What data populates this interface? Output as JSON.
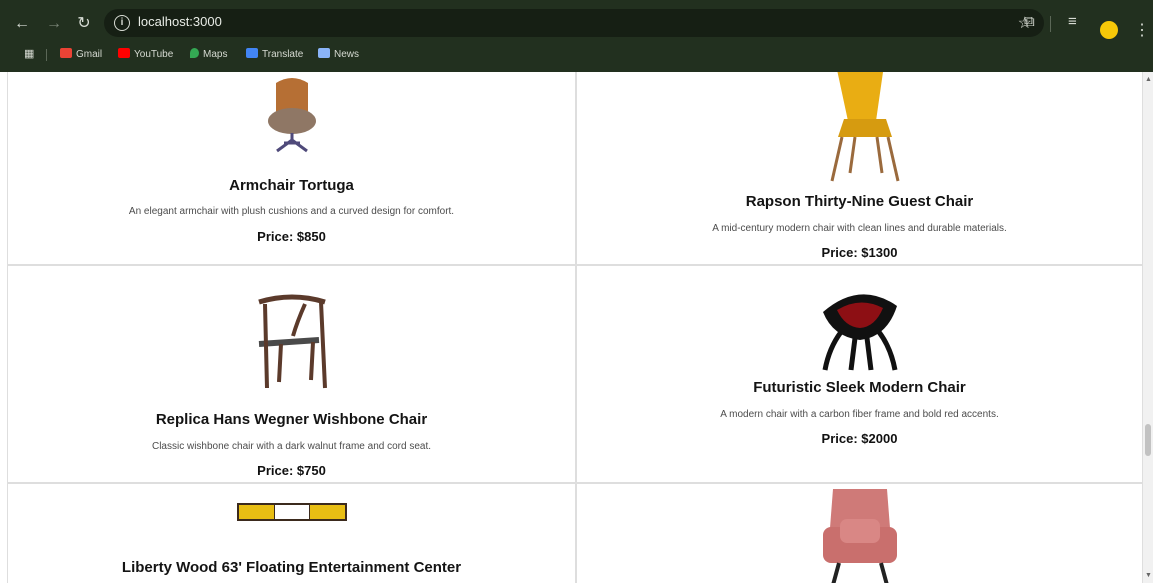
{
  "browser": {
    "url": "localhost:3000",
    "bookmarks": [
      {
        "label": "Gmail",
        "icon": "gmail-icon",
        "color": "#ea4335"
      },
      {
        "label": "YouTube",
        "icon": "youtube-icon",
        "color": "#ff0000"
      },
      {
        "label": "Maps",
        "icon": "maps-icon",
        "color": "#34a853"
      },
      {
        "label": "Translate",
        "icon": "translate-icon",
        "color": "#4285f4"
      },
      {
        "label": "News",
        "icon": "news-icon",
        "color": "#8ab4f8"
      }
    ]
  },
  "products": [
    {
      "title": "Armchair Tortuga",
      "description": "An elegant armchair with plush cushions and a curved design for comfort.",
      "price": "Price: $850"
    },
    {
      "title": "Rapson Thirty-Nine Guest Chair",
      "description": "A mid-century modern chair with clean lines and durable materials.",
      "price": "Price: $1300"
    },
    {
      "title": "Replica Hans Wegner Wishbone Chair",
      "description": "Classic wishbone chair with a dark walnut frame and cord seat.",
      "price": "Price: $750"
    },
    {
      "title": "Futuristic Sleek Modern Chair",
      "description": "A modern chair with a carbon fiber frame and bold red accents.",
      "price": "Price: $2000"
    },
    {
      "title": "Liberty Wood 63' Floating Entertainment Center",
      "description": "",
      "price": ""
    },
    {
      "title": "",
      "description": "",
      "price": ""
    }
  ]
}
